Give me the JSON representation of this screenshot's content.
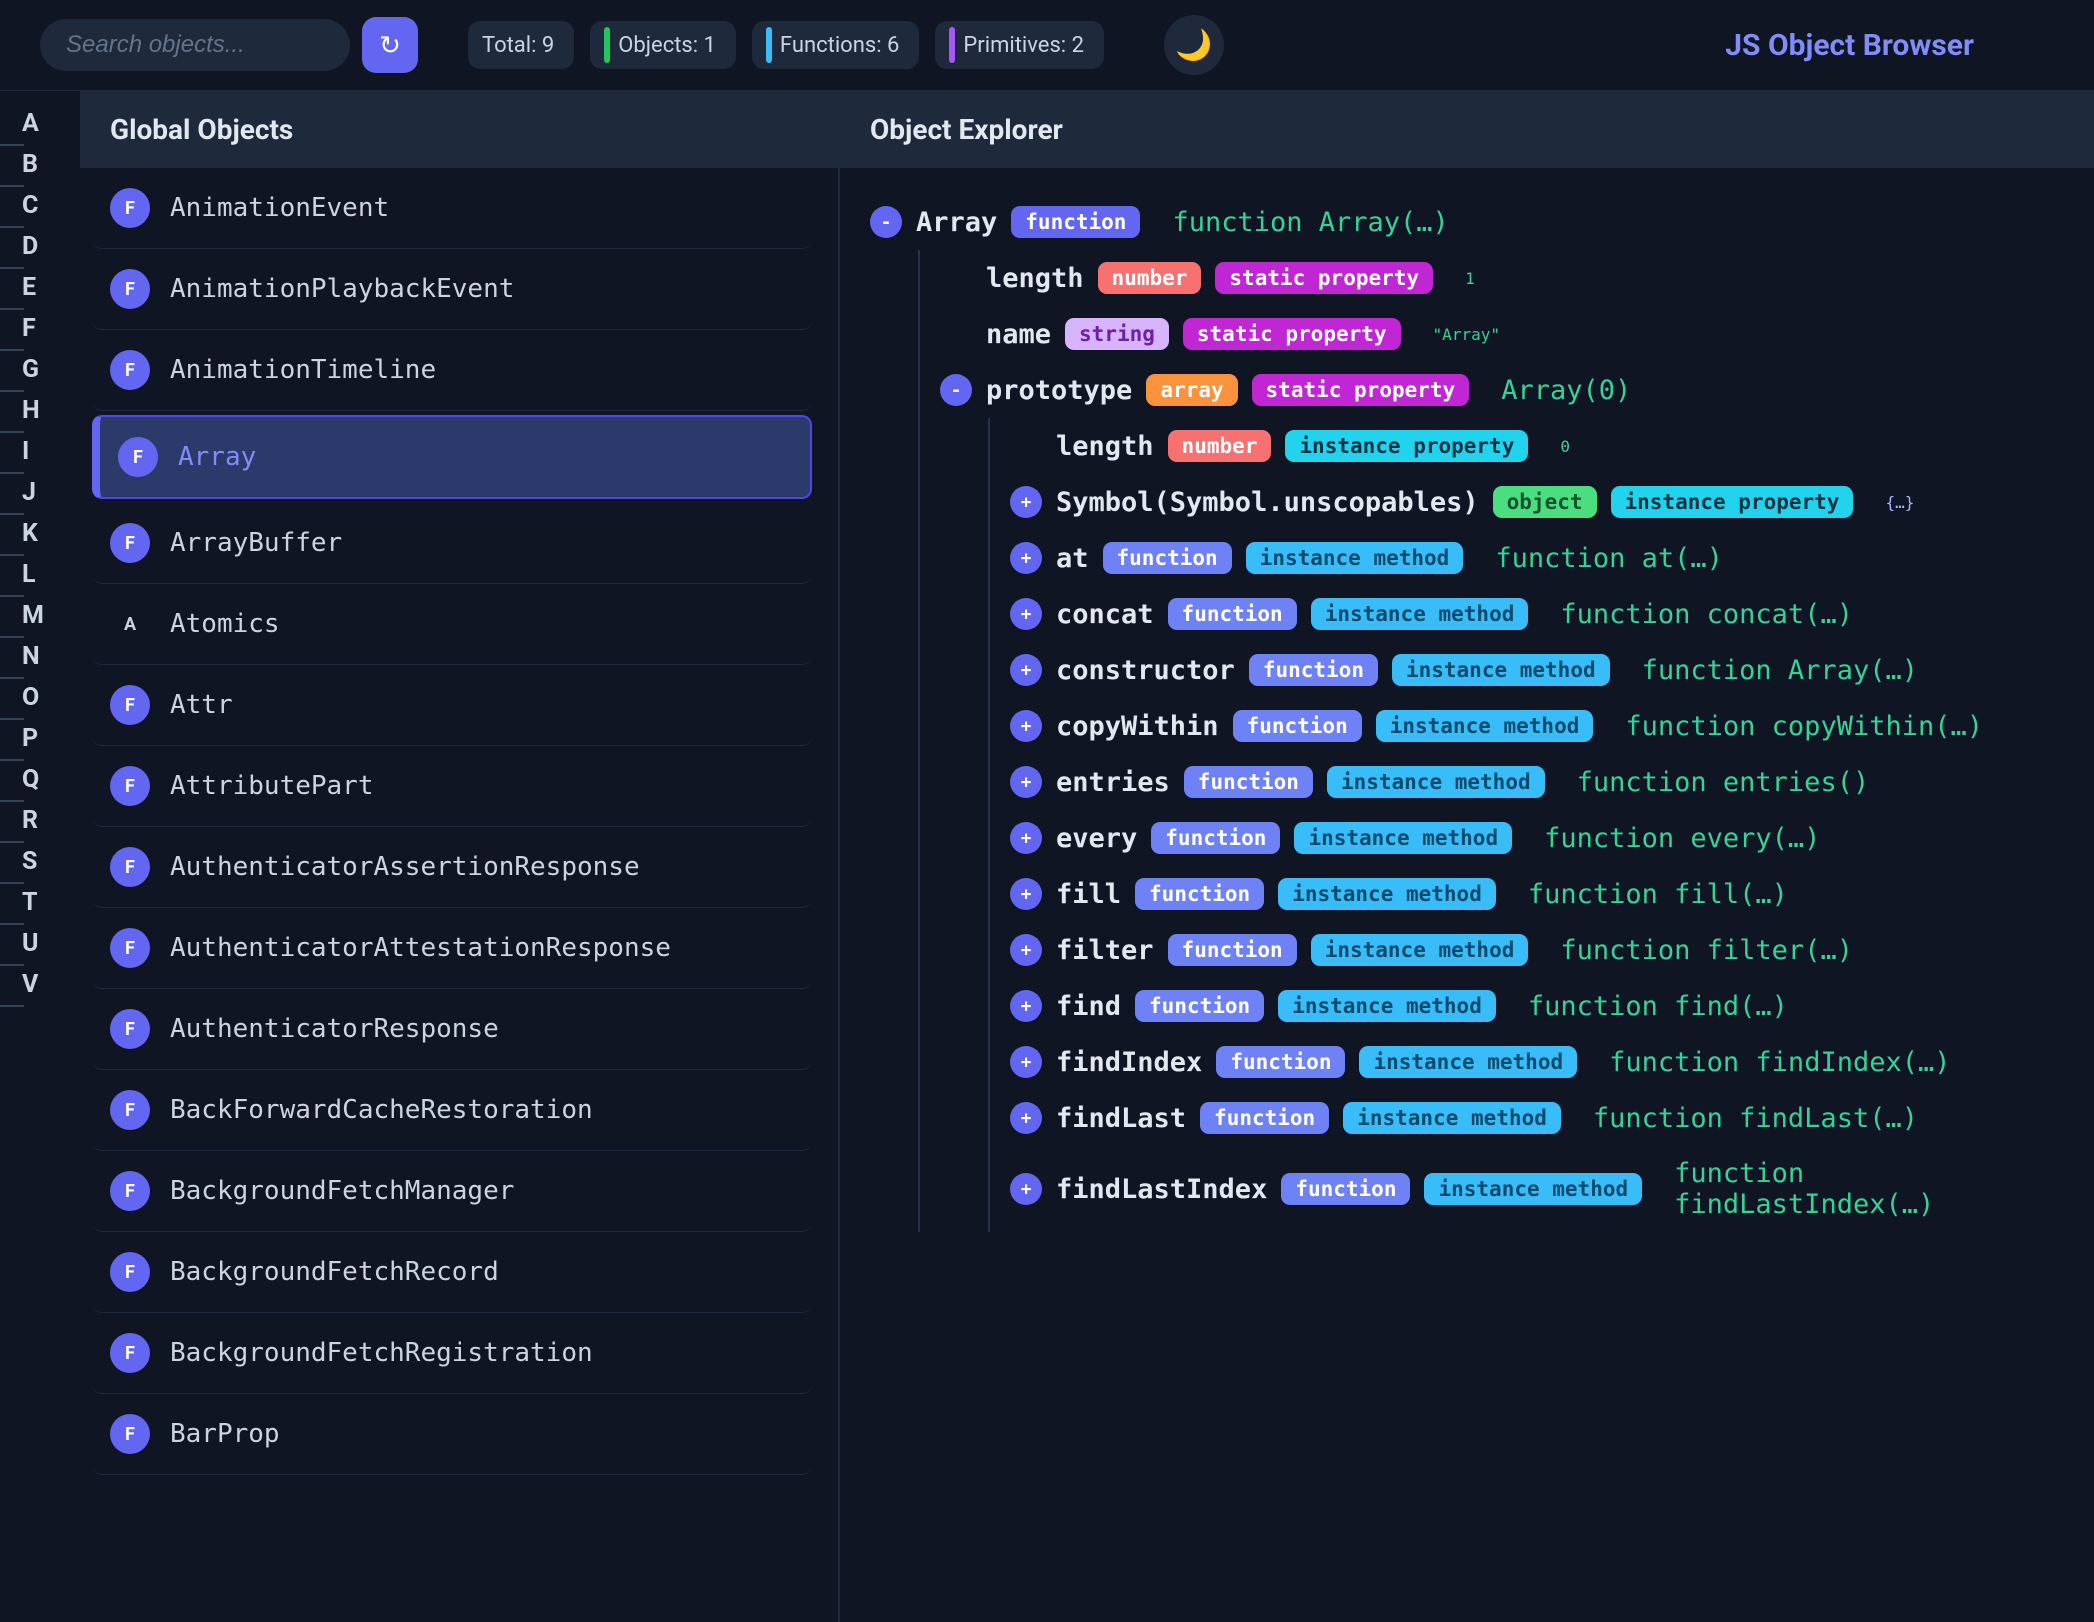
{
  "app": {
    "title": "JS Object Browser"
  },
  "search": {
    "placeholder": "Search objects...",
    "value": ""
  },
  "refresh_icon": "↻",
  "theme_icon": "🌙",
  "stats": {
    "total": "Total: 9",
    "objects": "Objects: 1",
    "functions": "Functions: 6",
    "primitives": "Primitives: 2"
  },
  "az": [
    "A",
    "B",
    "C",
    "D",
    "E",
    "F",
    "G",
    "H",
    "I",
    "J",
    "K",
    "L",
    "M",
    "N",
    "O",
    "P",
    "Q",
    "R",
    "S",
    "T",
    "U",
    "V"
  ],
  "sidebar": {
    "title": "Global Objects",
    "items": [
      {
        "badge": "F",
        "name": "AnimationEvent",
        "selected": false
      },
      {
        "badge": "F",
        "name": "AnimationPlaybackEvent",
        "selected": false
      },
      {
        "badge": "F",
        "name": "AnimationTimeline",
        "selected": false
      },
      {
        "badge": "F",
        "name": "Array",
        "selected": true
      },
      {
        "badge": "F",
        "name": "ArrayBuffer",
        "selected": false
      },
      {
        "badge": "A",
        "name": "Atomics",
        "selected": false
      },
      {
        "badge": "F",
        "name": "Attr",
        "selected": false
      },
      {
        "badge": "F",
        "name": "AttributePart",
        "selected": false
      },
      {
        "badge": "F",
        "name": "AuthenticatorAssertionResponse",
        "selected": false
      },
      {
        "badge": "F",
        "name": "AuthenticatorAttestationResponse",
        "selected": false
      },
      {
        "badge": "F",
        "name": "AuthenticatorResponse",
        "selected": false
      },
      {
        "badge": "F",
        "name": "BackForwardCacheRestoration",
        "selected": false
      },
      {
        "badge": "F",
        "name": "BackgroundFetchManager",
        "selected": false
      },
      {
        "badge": "F",
        "name": "BackgroundFetchRecord",
        "selected": false
      },
      {
        "badge": "F",
        "name": "BackgroundFetchRegistration",
        "selected": false
      },
      {
        "badge": "F",
        "name": "BarProp",
        "selected": false
      }
    ]
  },
  "explorer": {
    "title": "Object Explorer",
    "tree": {
      "root": {
        "exp": "-",
        "name": "Array",
        "tags": [
          {
            "cls": "tag-function",
            "label": "function"
          }
        ],
        "val": "function Array(…)",
        "valCls": "val"
      },
      "level1": [
        {
          "exp": "",
          "name": "length",
          "tags": [
            {
              "cls": "tag-number",
              "label": "number"
            },
            {
              "cls": "tag-static",
              "label": "static property"
            }
          ],
          "val": "1",
          "valCls": "val-num"
        },
        {
          "exp": "",
          "name": "name",
          "tags": [
            {
              "cls": "tag-string",
              "label": "string"
            },
            {
              "cls": "tag-static",
              "label": "static property"
            }
          ],
          "val": "\"Array\"",
          "valCls": "val-str"
        },
        {
          "exp": "-",
          "name": "prototype",
          "tags": [
            {
              "cls": "tag-array",
              "label": "array"
            },
            {
              "cls": "tag-static",
              "label": "static property"
            }
          ],
          "val": "Array(0)",
          "valCls": "val"
        }
      ],
      "level2": [
        {
          "exp": "",
          "name": "length",
          "tags": [
            {
              "cls": "tag-number",
              "label": "number"
            },
            {
              "cls": "tag-instprop",
              "label": "instance property"
            }
          ],
          "val": "0",
          "valCls": "val-num"
        },
        {
          "exp": "+",
          "name": "Symbol(Symbol.unscopables)",
          "tags": [
            {
              "cls": "tag-object",
              "label": "object"
            },
            {
              "cls": "tag-instprop",
              "label": "instance property"
            }
          ],
          "val": "{…}",
          "valCls": "val-obj"
        },
        {
          "exp": "+",
          "name": "at",
          "tags": [
            {
              "cls": "tag-function-light",
              "label": "function"
            },
            {
              "cls": "tag-instmeth",
              "label": "instance method"
            }
          ],
          "val": "function at(…)",
          "valCls": "val"
        },
        {
          "exp": "+",
          "name": "concat",
          "tags": [
            {
              "cls": "tag-function-light",
              "label": "function"
            },
            {
              "cls": "tag-instmeth",
              "label": "instance method"
            }
          ],
          "val": "function concat(…)",
          "valCls": "val"
        },
        {
          "exp": "+",
          "name": "constructor",
          "tags": [
            {
              "cls": "tag-function-light",
              "label": "function"
            },
            {
              "cls": "tag-instmeth",
              "label": "instance method"
            }
          ],
          "val": "function Array(…)",
          "valCls": "val"
        },
        {
          "exp": "+",
          "name": "copyWithin",
          "tags": [
            {
              "cls": "tag-function-light",
              "label": "function"
            },
            {
              "cls": "tag-instmeth",
              "label": "instance method"
            }
          ],
          "val": "function copyWithin(…)",
          "valCls": "val"
        },
        {
          "exp": "+",
          "name": "entries",
          "tags": [
            {
              "cls": "tag-function-light",
              "label": "function"
            },
            {
              "cls": "tag-instmeth",
              "label": "instance method"
            }
          ],
          "val": "function entries()",
          "valCls": "val"
        },
        {
          "exp": "+",
          "name": "every",
          "tags": [
            {
              "cls": "tag-function-light",
              "label": "function"
            },
            {
              "cls": "tag-instmeth",
              "label": "instance method"
            }
          ],
          "val": "function every(…)",
          "valCls": "val"
        },
        {
          "exp": "+",
          "name": "fill",
          "tags": [
            {
              "cls": "tag-function-light",
              "label": "function"
            },
            {
              "cls": "tag-instmeth",
              "label": "instance method"
            }
          ],
          "val": "function fill(…)",
          "valCls": "val"
        },
        {
          "exp": "+",
          "name": "filter",
          "tags": [
            {
              "cls": "tag-function-light",
              "label": "function"
            },
            {
              "cls": "tag-instmeth",
              "label": "instance method"
            }
          ],
          "val": "function filter(…)",
          "valCls": "val"
        },
        {
          "exp": "+",
          "name": "find",
          "tags": [
            {
              "cls": "tag-function-light",
              "label": "function"
            },
            {
              "cls": "tag-instmeth",
              "label": "instance method"
            }
          ],
          "val": "function find(…)",
          "valCls": "val"
        },
        {
          "exp": "+",
          "name": "findIndex",
          "tags": [
            {
              "cls": "tag-function-light",
              "label": "function"
            },
            {
              "cls": "tag-instmeth",
              "label": "instance method"
            }
          ],
          "val": "function findIndex(…)",
          "valCls": "val"
        },
        {
          "exp": "+",
          "name": "findLast",
          "tags": [
            {
              "cls": "tag-function-light",
              "label": "function"
            },
            {
              "cls": "tag-instmeth",
              "label": "instance method"
            }
          ],
          "val": "function findLast(…)",
          "valCls": "val"
        },
        {
          "exp": "+",
          "name": "findLastIndex",
          "tags": [
            {
              "cls": "tag-function-light",
              "label": "function"
            },
            {
              "cls": "tag-instmeth",
              "label": "instance method"
            }
          ],
          "val": "function findLastIndex(…)",
          "valCls": "val"
        }
      ]
    }
  }
}
